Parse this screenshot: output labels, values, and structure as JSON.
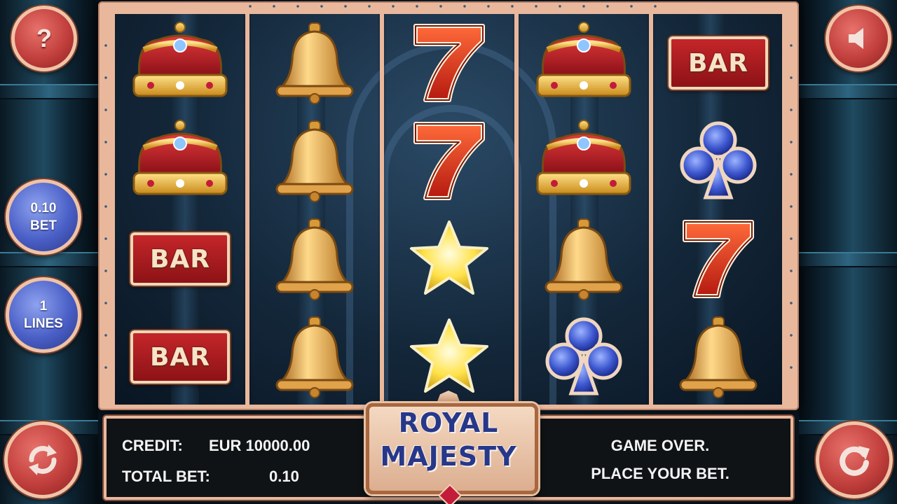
{
  "game": {
    "title_line1": "ROYAL",
    "title_line2": "MAJESTY"
  },
  "buttons": {
    "help_label": "?",
    "bet_value": "0.10",
    "bet_label": "BET",
    "lines_value": "1",
    "lines_label": "LINES",
    "sound_icon": "speaker-icon",
    "autoplay_icon": "autoplay-icon",
    "spin_icon": "spin-icon"
  },
  "info": {
    "credit_label": "CREDIT:",
    "credit_value": "EUR 10000.00",
    "total_bet_label": "TOTAL BET:",
    "total_bet_value": "0.10",
    "status_line1": "GAME OVER.",
    "status_line2": "PLACE YOUR BET."
  },
  "reels": [
    [
      "crown",
      "crown",
      "bar",
      "bar"
    ],
    [
      "bell",
      "bell",
      "bell",
      "bell"
    ],
    [
      "seven",
      "seven",
      "star",
      "star"
    ],
    [
      "crown",
      "crown",
      "bell",
      "club"
    ],
    [
      "bar",
      "club",
      "seven",
      "bell"
    ]
  ],
  "symbol_text": {
    "bar": "BAR"
  },
  "colors": {
    "frame": "#e9b89c",
    "red_button": "#c2403d",
    "blue_button": "#4a5fc6",
    "logo_text": "#27378a"
  }
}
